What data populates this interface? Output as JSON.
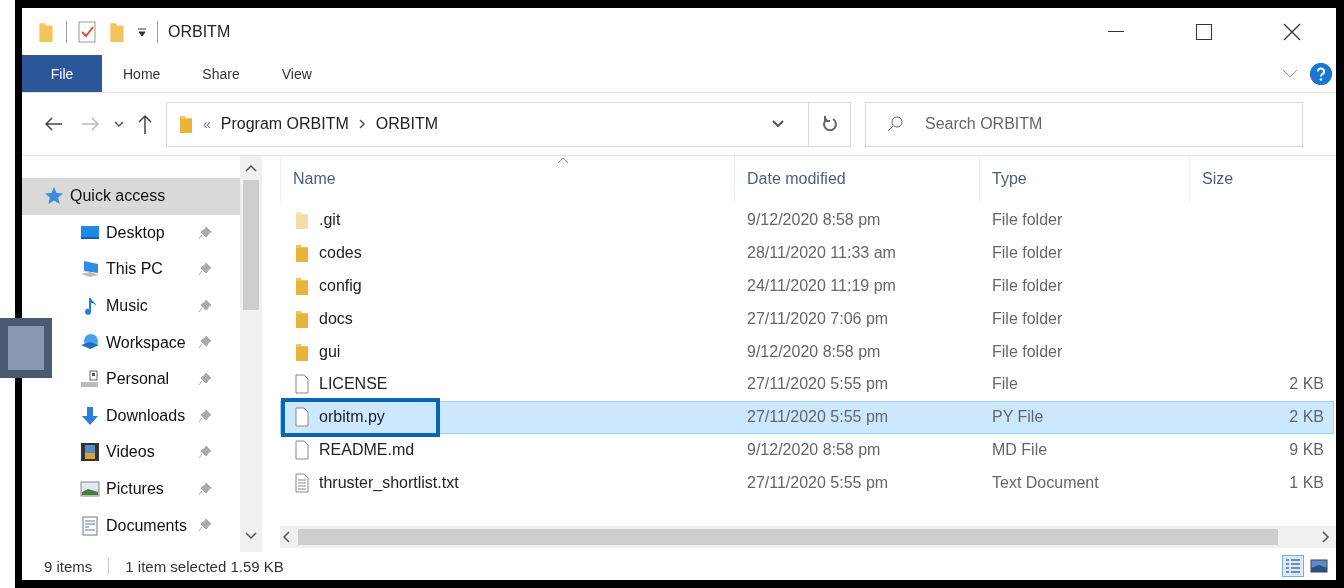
{
  "window": {
    "title": "ORBITM"
  },
  "ribbon": {
    "tabs": [
      {
        "label": "File",
        "kind": "file",
        "selected": false
      },
      {
        "label": "Home",
        "kind": "tab",
        "selected": false
      },
      {
        "label": "Share",
        "kind": "tab",
        "selected": false
      },
      {
        "label": "View",
        "kind": "tab",
        "selected": false
      }
    ]
  },
  "address_bar": {
    "overflow": "«",
    "breadcrumbs": [
      "Program ORBITM",
      "ORBITM"
    ],
    "search_placeholder": "Search ORBITM"
  },
  "sidebar": {
    "items": [
      {
        "label": "Quick access",
        "pinned": false,
        "selected": true
      },
      {
        "label": "Desktop",
        "pinned": true,
        "selected": false
      },
      {
        "label": "This PC",
        "pinned": true,
        "selected": false
      },
      {
        "label": "Music",
        "pinned": true,
        "selected": false
      },
      {
        "label": "Workspace",
        "pinned": true,
        "selected": false
      },
      {
        "label": "Personal",
        "pinned": true,
        "selected": false
      },
      {
        "label": "Downloads",
        "pinned": true,
        "selected": false
      },
      {
        "label": "Videos",
        "pinned": true,
        "selected": false
      },
      {
        "label": "Pictures",
        "pinned": true,
        "selected": false
      },
      {
        "label": "Documents",
        "pinned": true,
        "selected": false
      }
    ]
  },
  "table": {
    "columns": [
      "Name",
      "Date modified",
      "Type",
      "Size"
    ],
    "rows": [
      {
        "name": ".git",
        "kind": "folder",
        "hidden": true,
        "date": "9/12/2020 8:58 pm",
        "type": "File folder",
        "selected": false,
        "highlighted": false
      },
      {
        "name": "codes",
        "kind": "folder",
        "hidden": false,
        "date": "28/11/2020 11:33 am",
        "type": "File folder",
        "selected": false,
        "highlighted": false
      },
      {
        "name": "config",
        "kind": "folder",
        "hidden": false,
        "date": "24/11/2020 11:19 pm",
        "type": "File folder",
        "selected": false,
        "highlighted": false
      },
      {
        "name": "docs",
        "kind": "folder",
        "hidden": false,
        "date": "27/11/2020 7:06 pm",
        "type": "File folder",
        "selected": false,
        "highlighted": false
      },
      {
        "name": "gui",
        "kind": "folder",
        "hidden": false,
        "date": "9/12/2020 8:58 pm",
        "type": "File folder",
        "selected": false,
        "highlighted": false
      },
      {
        "name": "LICENSE",
        "kind": "file",
        "hidden": false,
        "date": "27/11/2020 5:55 pm",
        "type": "File",
        "size": "2 KB",
        "selected": false,
        "highlighted": false
      },
      {
        "name": "orbitm.py",
        "kind": "file",
        "hidden": false,
        "date": "27/11/2020 5:55 pm",
        "type": "PY File",
        "size": "2 KB",
        "selected": true,
        "highlighted": true
      },
      {
        "name": "README.md",
        "kind": "file",
        "hidden": false,
        "date": "9/12/2020 8:58 pm",
        "type": "MD File",
        "size": "9 KB",
        "selected": false,
        "highlighted": false
      },
      {
        "name": "thruster_shortlist.txt",
        "kind": "text",
        "hidden": false,
        "date": "27/11/2020 5:55 pm",
        "type": "Text Document",
        "size": "1 KB",
        "selected": false,
        "highlighted": false
      }
    ]
  },
  "status_bar": {
    "item_count": "9 items",
    "selection": "1 item selected",
    "selection_size": "1.59 KB"
  }
}
